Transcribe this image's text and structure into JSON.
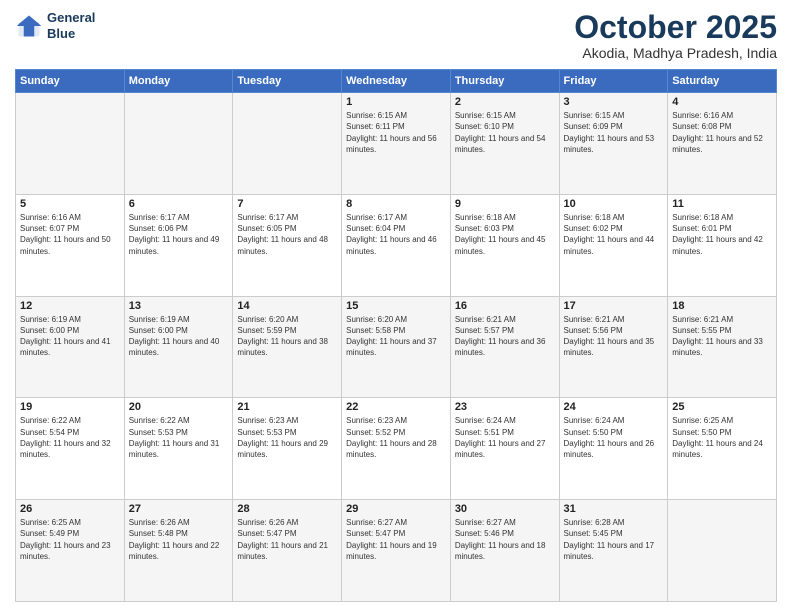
{
  "logo": {
    "line1": "General",
    "line2": "Blue"
  },
  "header": {
    "month": "October 2025",
    "location": "Akodia, Madhya Pradesh, India"
  },
  "weekdays": [
    "Sunday",
    "Monday",
    "Tuesday",
    "Wednesday",
    "Thursday",
    "Friday",
    "Saturday"
  ],
  "weeks": [
    [
      {
        "day": "",
        "sunrise": "",
        "sunset": "",
        "daylight": ""
      },
      {
        "day": "",
        "sunrise": "",
        "sunset": "",
        "daylight": ""
      },
      {
        "day": "",
        "sunrise": "",
        "sunset": "",
        "daylight": ""
      },
      {
        "day": "1",
        "sunrise": "Sunrise: 6:15 AM",
        "sunset": "Sunset: 6:11 PM",
        "daylight": "Daylight: 11 hours and 56 minutes."
      },
      {
        "day": "2",
        "sunrise": "Sunrise: 6:15 AM",
        "sunset": "Sunset: 6:10 PM",
        "daylight": "Daylight: 11 hours and 54 minutes."
      },
      {
        "day": "3",
        "sunrise": "Sunrise: 6:15 AM",
        "sunset": "Sunset: 6:09 PM",
        "daylight": "Daylight: 11 hours and 53 minutes."
      },
      {
        "day": "4",
        "sunrise": "Sunrise: 6:16 AM",
        "sunset": "Sunset: 6:08 PM",
        "daylight": "Daylight: 11 hours and 52 minutes."
      }
    ],
    [
      {
        "day": "5",
        "sunrise": "Sunrise: 6:16 AM",
        "sunset": "Sunset: 6:07 PM",
        "daylight": "Daylight: 11 hours and 50 minutes."
      },
      {
        "day": "6",
        "sunrise": "Sunrise: 6:17 AM",
        "sunset": "Sunset: 6:06 PM",
        "daylight": "Daylight: 11 hours and 49 minutes."
      },
      {
        "day": "7",
        "sunrise": "Sunrise: 6:17 AM",
        "sunset": "Sunset: 6:05 PM",
        "daylight": "Daylight: 11 hours and 48 minutes."
      },
      {
        "day": "8",
        "sunrise": "Sunrise: 6:17 AM",
        "sunset": "Sunset: 6:04 PM",
        "daylight": "Daylight: 11 hours and 46 minutes."
      },
      {
        "day": "9",
        "sunrise": "Sunrise: 6:18 AM",
        "sunset": "Sunset: 6:03 PM",
        "daylight": "Daylight: 11 hours and 45 minutes."
      },
      {
        "day": "10",
        "sunrise": "Sunrise: 6:18 AM",
        "sunset": "Sunset: 6:02 PM",
        "daylight": "Daylight: 11 hours and 44 minutes."
      },
      {
        "day": "11",
        "sunrise": "Sunrise: 6:18 AM",
        "sunset": "Sunset: 6:01 PM",
        "daylight": "Daylight: 11 hours and 42 minutes."
      }
    ],
    [
      {
        "day": "12",
        "sunrise": "Sunrise: 6:19 AM",
        "sunset": "Sunset: 6:00 PM",
        "daylight": "Daylight: 11 hours and 41 minutes."
      },
      {
        "day": "13",
        "sunrise": "Sunrise: 6:19 AM",
        "sunset": "Sunset: 6:00 PM",
        "daylight": "Daylight: 11 hours and 40 minutes."
      },
      {
        "day": "14",
        "sunrise": "Sunrise: 6:20 AM",
        "sunset": "Sunset: 5:59 PM",
        "daylight": "Daylight: 11 hours and 38 minutes."
      },
      {
        "day": "15",
        "sunrise": "Sunrise: 6:20 AM",
        "sunset": "Sunset: 5:58 PM",
        "daylight": "Daylight: 11 hours and 37 minutes."
      },
      {
        "day": "16",
        "sunrise": "Sunrise: 6:21 AM",
        "sunset": "Sunset: 5:57 PM",
        "daylight": "Daylight: 11 hours and 36 minutes."
      },
      {
        "day": "17",
        "sunrise": "Sunrise: 6:21 AM",
        "sunset": "Sunset: 5:56 PM",
        "daylight": "Daylight: 11 hours and 35 minutes."
      },
      {
        "day": "18",
        "sunrise": "Sunrise: 6:21 AM",
        "sunset": "Sunset: 5:55 PM",
        "daylight": "Daylight: 11 hours and 33 minutes."
      }
    ],
    [
      {
        "day": "19",
        "sunrise": "Sunrise: 6:22 AM",
        "sunset": "Sunset: 5:54 PM",
        "daylight": "Daylight: 11 hours and 32 minutes."
      },
      {
        "day": "20",
        "sunrise": "Sunrise: 6:22 AM",
        "sunset": "Sunset: 5:53 PM",
        "daylight": "Daylight: 11 hours and 31 minutes."
      },
      {
        "day": "21",
        "sunrise": "Sunrise: 6:23 AM",
        "sunset": "Sunset: 5:53 PM",
        "daylight": "Daylight: 11 hours and 29 minutes."
      },
      {
        "day": "22",
        "sunrise": "Sunrise: 6:23 AM",
        "sunset": "Sunset: 5:52 PM",
        "daylight": "Daylight: 11 hours and 28 minutes."
      },
      {
        "day": "23",
        "sunrise": "Sunrise: 6:24 AM",
        "sunset": "Sunset: 5:51 PM",
        "daylight": "Daylight: 11 hours and 27 minutes."
      },
      {
        "day": "24",
        "sunrise": "Sunrise: 6:24 AM",
        "sunset": "Sunset: 5:50 PM",
        "daylight": "Daylight: 11 hours and 26 minutes."
      },
      {
        "day": "25",
        "sunrise": "Sunrise: 6:25 AM",
        "sunset": "Sunset: 5:50 PM",
        "daylight": "Daylight: 11 hours and 24 minutes."
      }
    ],
    [
      {
        "day": "26",
        "sunrise": "Sunrise: 6:25 AM",
        "sunset": "Sunset: 5:49 PM",
        "daylight": "Daylight: 11 hours and 23 minutes."
      },
      {
        "day": "27",
        "sunrise": "Sunrise: 6:26 AM",
        "sunset": "Sunset: 5:48 PM",
        "daylight": "Daylight: 11 hours and 22 minutes."
      },
      {
        "day": "28",
        "sunrise": "Sunrise: 6:26 AM",
        "sunset": "Sunset: 5:47 PM",
        "daylight": "Daylight: 11 hours and 21 minutes."
      },
      {
        "day": "29",
        "sunrise": "Sunrise: 6:27 AM",
        "sunset": "Sunset: 5:47 PM",
        "daylight": "Daylight: 11 hours and 19 minutes."
      },
      {
        "day": "30",
        "sunrise": "Sunrise: 6:27 AM",
        "sunset": "Sunset: 5:46 PM",
        "daylight": "Daylight: 11 hours and 18 minutes."
      },
      {
        "day": "31",
        "sunrise": "Sunrise: 6:28 AM",
        "sunset": "Sunset: 5:45 PM",
        "daylight": "Daylight: 11 hours and 17 minutes."
      },
      {
        "day": "",
        "sunrise": "",
        "sunset": "",
        "daylight": ""
      }
    ]
  ]
}
